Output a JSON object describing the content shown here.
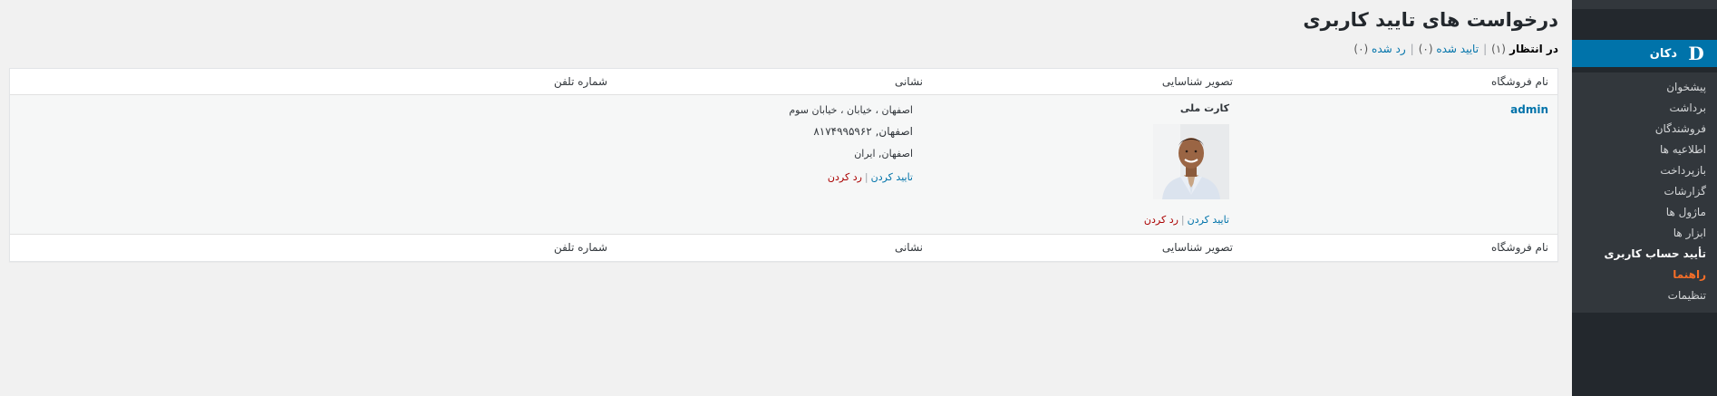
{
  "sidebar": {
    "parent_label": "دکان",
    "parent_icon": "dokan-logo-icon",
    "logo_letter": "D",
    "items": [
      {
        "label": "پیشخوان"
      },
      {
        "label": "برداشت"
      },
      {
        "label": "فروشندگان"
      },
      {
        "label": "اطلاعیه ها"
      },
      {
        "label": "بازپرداخت"
      },
      {
        "label": "گزارشات"
      },
      {
        "label": "ماژول ها"
      },
      {
        "label": "ابزار ها"
      },
      {
        "label": "تأیید حساب کاربری",
        "current": true
      },
      {
        "label": "راهنما",
        "highlight": true
      },
      {
        "label": "تنظیمات"
      }
    ]
  },
  "page": {
    "title": "درخواست های تایید کاربری"
  },
  "filters": {
    "pending_label": "در انتظار",
    "pending_count": "(۱)",
    "approved_label": "تایید شده",
    "approved_count": "(۰)",
    "rejected_label": "رد شده",
    "rejected_count": "(۰)",
    "separator": "|"
  },
  "table": {
    "columns": {
      "store": "نام فروشگاه",
      "id_image": "تصویر شناسایی",
      "address": "نشانی",
      "phone": "شماره تلفن"
    },
    "row": {
      "store_name": "admin",
      "id_type": "کارت ملی",
      "address_line1": "اصفهان ، خیابان ، خیابان سوم",
      "address_line2": "اصفهان, ۸۱۷۴۹۹۵۹۶۲",
      "address_line3": "اصفهان, ایران",
      "approve_label": "تایید کردن",
      "reject_label": "رد کردن",
      "action_sep": "|"
    }
  },
  "colors": {
    "sidebar_bg": "#23282d",
    "submenu_bg": "#32373c",
    "accent": "#0073aa",
    "highlight": "#f56e28",
    "reject": "#aa0000"
  }
}
